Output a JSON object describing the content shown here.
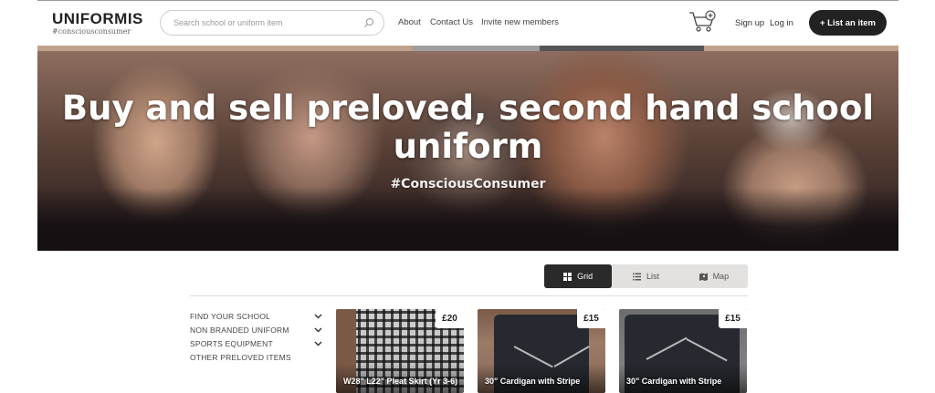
{
  "header": {
    "logo_main": "UNIFORMIS",
    "logo_sub": "#consciousconsumer",
    "search_placeholder": "Search school or uniform item",
    "nav": [
      "About",
      "Contact Us",
      "Invite new members"
    ],
    "signup": "Sign up",
    "login": "Log in",
    "list_item": "+ List an item"
  },
  "hero": {
    "title": "Buy and sell preloved, second hand school uniform",
    "subtitle": "#ConsciousConsumer"
  },
  "view_toggle": {
    "options": [
      "Grid",
      "List",
      "Map"
    ],
    "active": "Grid"
  },
  "sidebar": {
    "items": [
      {
        "label": "FIND YOUR SCHOOL",
        "expandable": true
      },
      {
        "label": "NON BRANDED UNIFORM",
        "expandable": true
      },
      {
        "label": "SPORTS EQUIPMENT",
        "expandable": true
      },
      {
        "label": "OTHER PRELOVED ITEMS",
        "expandable": false
      }
    ]
  },
  "products": [
    {
      "price": "£20",
      "title": "W28\" L22\" Pleat Skirt (Yr 3-6)"
    },
    {
      "price": "£15",
      "title": "30\" Cardigan with Stripe"
    },
    {
      "price": "£15",
      "title": "30\" Cardigan with Stripe"
    }
  ],
  "colors": {
    "primary_button": "#222222",
    "toggle_active": "#2a2a2a",
    "toggle_bg": "#e3e1e0"
  }
}
